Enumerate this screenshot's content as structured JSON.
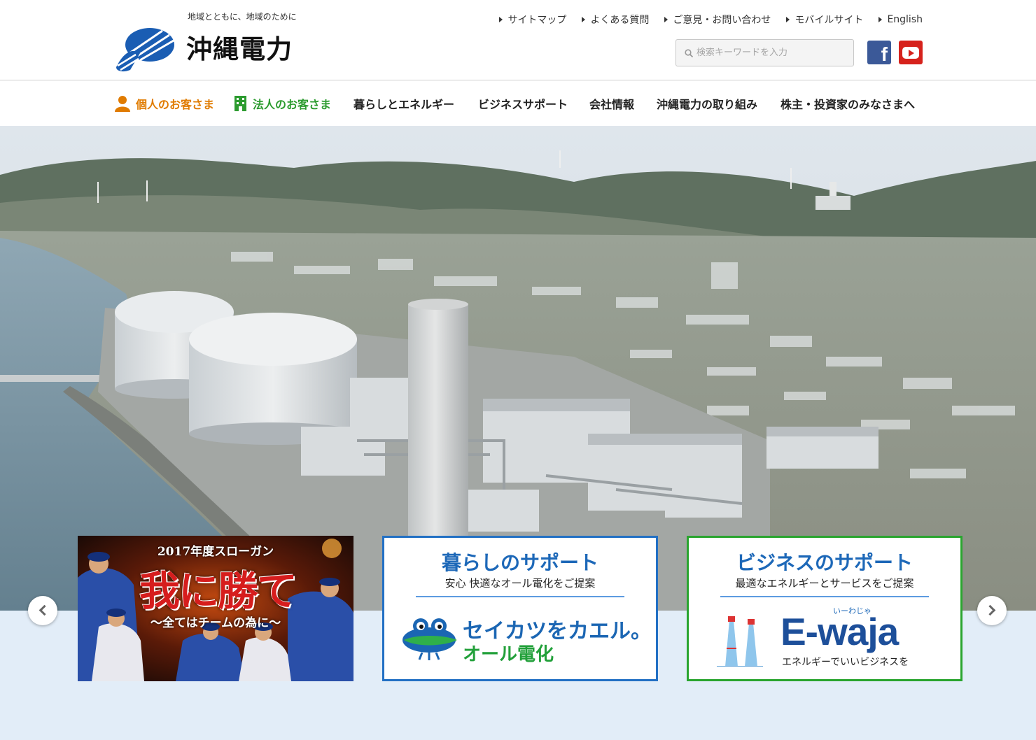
{
  "header": {
    "tagline": "地域とともに、地域のために",
    "company_name": "沖縄電力",
    "util_links": [
      "サイトマップ",
      "よくある質問",
      "ご意見・お問い合わせ",
      "モバイルサイト",
      "English"
    ],
    "search_placeholder": "検索キーワードを入力",
    "social": [
      "facebook-icon",
      "youtube-icon"
    ]
  },
  "nav": {
    "personal": "個人のお客さま",
    "corporate": "法人のお客さま",
    "items": [
      "暮らしとエネルギー",
      "ビジネスサポート",
      "会社情報",
      "沖縄電力の取り組み",
      "株主・投資家のみなさまへ"
    ]
  },
  "cards": {
    "slogan": {
      "heading": "2017年度スローガン",
      "main": "我に勝て",
      "sub": "～全てはチームの為に～"
    },
    "living": {
      "title": "暮らしのサポート",
      "subtitle": "安心 快適なオール電化をご提案",
      "logo_line1": "セイカツをカエル。",
      "logo_line2": "オール電化"
    },
    "business": {
      "title": "ビジネスのサポート",
      "subtitle": "最適なエネルギーとサービスをご提案",
      "ruby": "いーわじゃ",
      "logo": "E-waja",
      "tagline": "エネルギーでいいビジネスを"
    }
  },
  "colors": {
    "personal": "#e07b00",
    "corporate": "#2c9b2f",
    "living_border": "#2270c4",
    "business_border": "#2aa52f",
    "band": "#e2edf8"
  }
}
